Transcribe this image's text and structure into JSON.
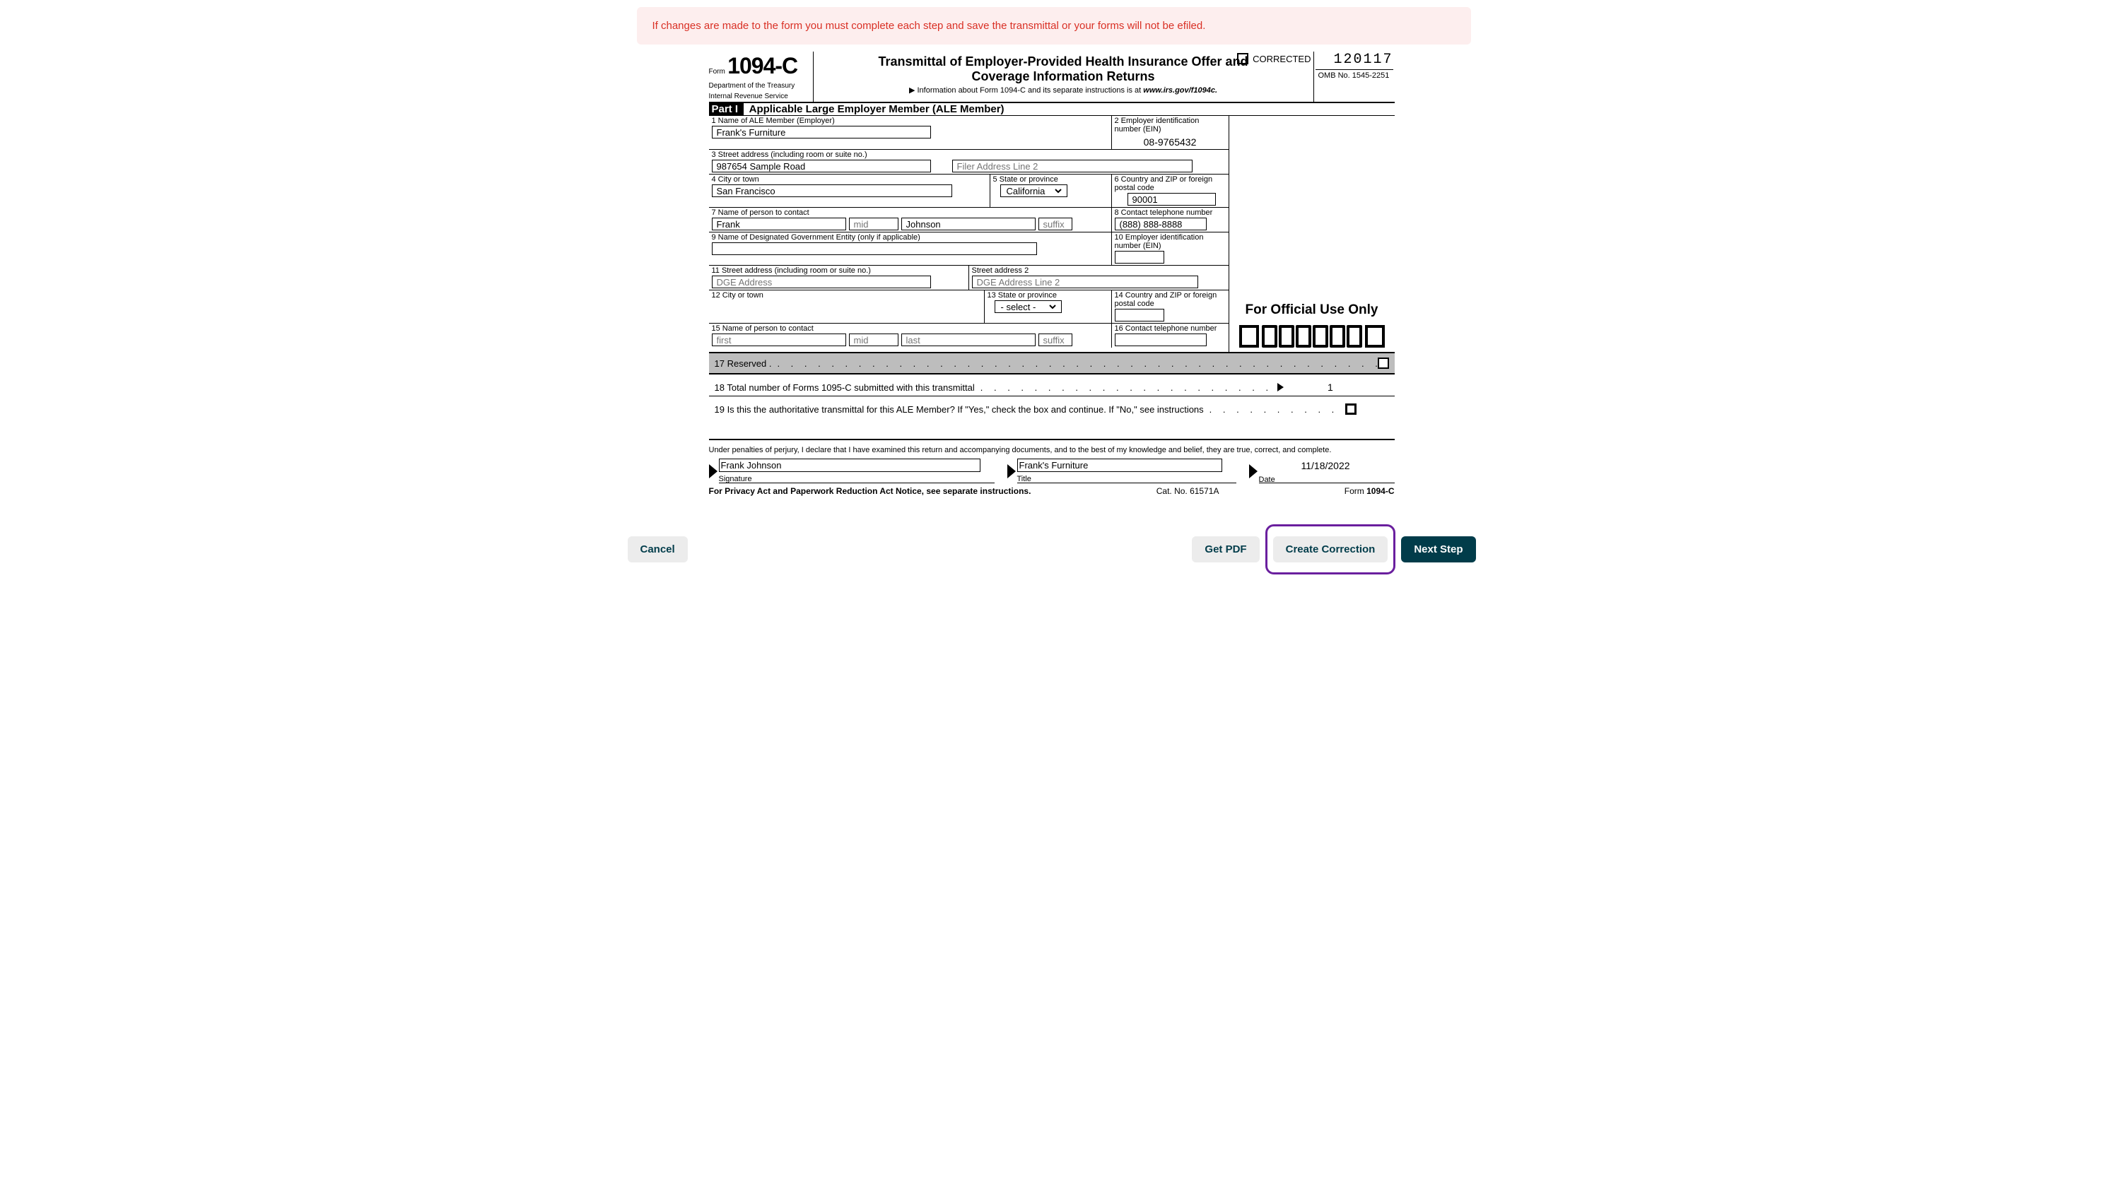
{
  "warning": "If changes are made to the form you must complete each step and save the transmittal or your forms will not be efiled.",
  "header": {
    "form_label": "Form",
    "form_number": "1094-C",
    "dept_line1": "Department of the Treasury",
    "dept_line2": "Internal Revenue Service",
    "title1": "Transmittal of Employer-Provided Health Insurance Offer and",
    "title2": "Coverage Information Returns",
    "info_prefix": "▶ Information about Form 1094-C and its separate instructions is at ",
    "info_url": "www.irs.gov/f1094c.",
    "code": "120117",
    "omb": "OMB No. 1545-2251",
    "corrected_label": "CORRECTED"
  },
  "partI": {
    "pill": "Part I",
    "title": "Applicable Large Employer Member (ALE Member)"
  },
  "fields": {
    "l1": {
      "lbl": "1   Name of ALE Member (Employer)",
      "val": "Frank's Furniture"
    },
    "l2": {
      "lbl": "2 Employer identification number (EIN)",
      "val": "08-9765432"
    },
    "l3": {
      "lbl": "3   Street address (including room or suite no.)",
      "val": "987654 Sample Road",
      "ph2": "Filer Address Line 2"
    },
    "l4": {
      "lbl": "4   City or town",
      "val": "San Francisco"
    },
    "l5": {
      "lbl": "5  State or province",
      "val": "California"
    },
    "l6": {
      "lbl": "6 Country and ZIP or foreign postal code",
      "val": "90001"
    },
    "l7": {
      "lbl": "7   Name of person to contact",
      "first": "Frank",
      "ph_mid": "mid",
      "last": "Johnson",
      "ph_suffix": "suffix"
    },
    "l8": {
      "lbl": "8 Contact telephone number",
      "val": "(888) 888-8888"
    },
    "l9": {
      "lbl": "9   Name of Designated Government Entity (only if applicable)",
      "val": ""
    },
    "l10": {
      "lbl": "10 Employer identification number (EIN)",
      "val": ""
    },
    "l11": {
      "lbl": "11  Street address (including room or suite no.)",
      "ph": "DGE Address",
      "lbl2": "Street address 2",
      "ph2": "DGE Address Line 2"
    },
    "l12": {
      "lbl": "12  City or town"
    },
    "l13": {
      "lbl": "13 State or province",
      "sel": "- select -"
    },
    "l14": {
      "lbl": "14  Country and ZIP or foreign postal code"
    },
    "l15": {
      "lbl": "15  Name of person to contact",
      "ph_first": "first",
      "ph_mid": "mid",
      "ph_last": "last",
      "ph_suffix": "suffix"
    },
    "l16": {
      "lbl": "16 Contact telephone number"
    }
  },
  "official_use": "For Official Use Only",
  "l17": "17   Reserved .",
  "l18": {
    "text": "18   Total number of Forms 1095-C submitted with this transmittal",
    "val": "1"
  },
  "l19": "19   Is this the authoritative transmittal for this ALE Member? If \"Yes,\" check the box and continue. If \"No,\" see instructions",
  "perjury": "Under penalties of perjury, I declare that I have examined this return and accompanying documents, and to the best of my knowledge and belief, they are true, correct, and complete.",
  "sig": {
    "name": "Frank Johnson",
    "name_lbl": "Signature",
    "title": "Frank's Furniture",
    "title_lbl": "Title",
    "date": "11/18/2022",
    "date_lbl": "Date"
  },
  "footer": {
    "left": "For Privacy Act and Paperwork Reduction Act Notice, see separate instructions.",
    "center": "Cat. No. 61571A",
    "right_form": "Form",
    "right_num": "1094-C"
  },
  "buttons": {
    "cancel": "Cancel",
    "pdf": "Get PDF",
    "correction": "Create Correction",
    "next": "Next Step"
  },
  "dots": ".   .   .   .   .   .   .   .   .   .   .   .   .   .   .   .   .   .   .   .   .   .   .   .   .   .   .   .   .   .   .   .   .   .   .   .   .   .   .   .   .   .   .   .   .   .   .   .   .   .   .   .   .   .   .   .   .   .   .   .   .   .   .   .   .   .   ."
}
